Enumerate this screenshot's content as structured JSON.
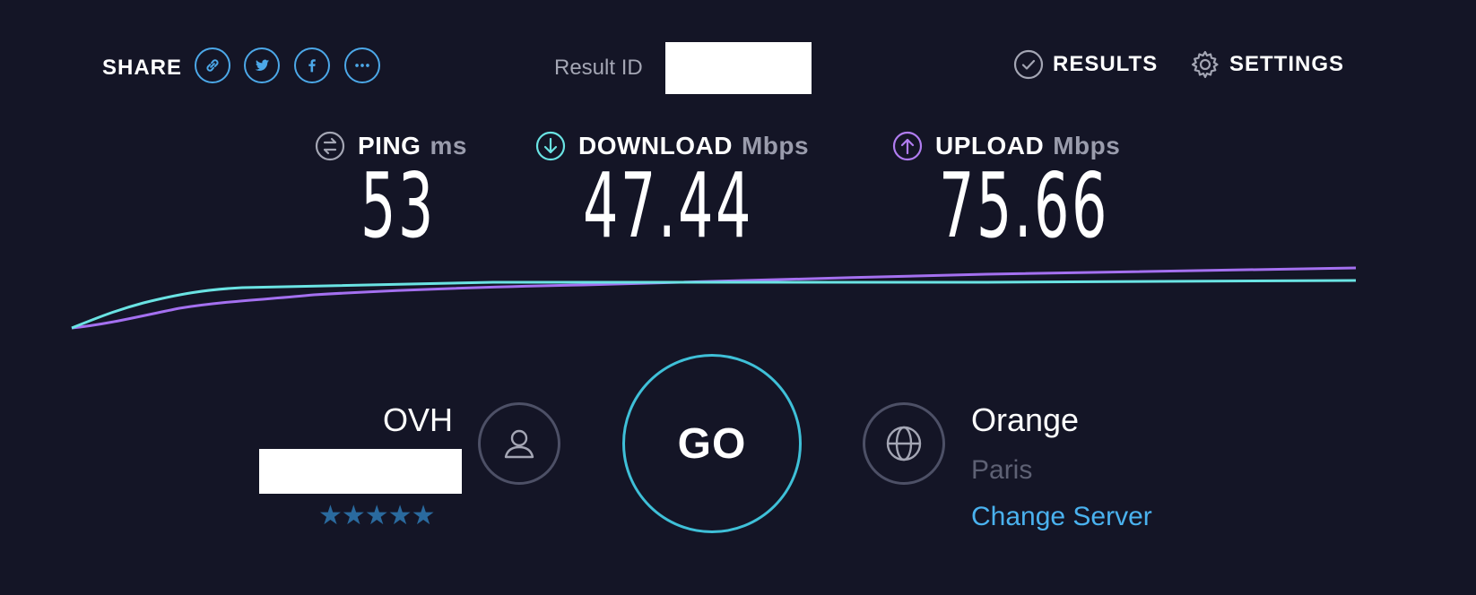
{
  "header": {
    "share_label": "SHARE",
    "share_icons": [
      "link-icon",
      "twitter-icon",
      "facebook-icon",
      "more-icon"
    ],
    "result_id_label": "Result ID",
    "results_label": "RESULTS",
    "settings_label": "SETTINGS"
  },
  "metrics": {
    "ping": {
      "label": "PING",
      "unit": "ms",
      "value": "53",
      "icon": "ping-icon",
      "color": "#a4a6b4"
    },
    "download": {
      "label": "DOWNLOAD",
      "unit": "Mbps",
      "value": "47.44",
      "icon": "download-arrow-icon",
      "color": "#6ae3e3"
    },
    "upload": {
      "label": "UPLOAD",
      "unit": "Mbps",
      "value": "75.66",
      "icon": "upload-arrow-icon",
      "color": "#b07cf0"
    }
  },
  "isp": {
    "name": "OVH",
    "rating_stars": "★★★★★",
    "rating": 5
  },
  "go_label": "GO",
  "server": {
    "name": "Orange",
    "location": "Paris",
    "change_label": "Change Server"
  },
  "colors": {
    "background": "#141526",
    "accent_blue": "#4ca8e8",
    "download_line": "#6ae3e3",
    "upload_line": "#a470f0"
  }
}
